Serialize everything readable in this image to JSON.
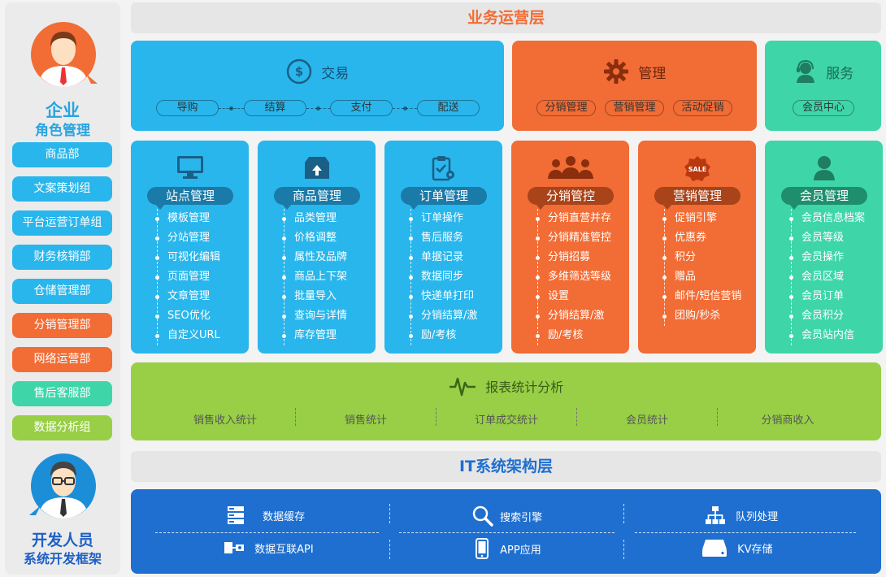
{
  "sidebar": {
    "enterprise_title": "企业",
    "enterprise_subtitle": "角色管理",
    "departments": [
      {
        "label": "商品部",
        "color": "#29b6ec"
      },
      {
        "label": "文案策划组",
        "color": "#29b6ec"
      },
      {
        "label": "平台运营订单组",
        "color": "#29b6ec"
      },
      {
        "label": "财务核销部",
        "color": "#29b6ec"
      },
      {
        "label": "仓储管理部",
        "color": "#29b6ec"
      },
      {
        "label": "分销管理部",
        "color": "#f26c35"
      },
      {
        "label": "网络运营部",
        "color": "#f26c35"
      },
      {
        "label": "售后客服部",
        "color": "#3ed6a9"
      },
      {
        "label": "数据分析组",
        "color": "#98cf46"
      }
    ],
    "developer_title": "开发人员",
    "developer_subtitle": "系统开发框架"
  },
  "business_layer": {
    "title": "业务运营层",
    "title_color": "#f26c35",
    "trade": {
      "title": "交易",
      "steps": [
        "导购",
        "结算",
        "支付",
        "配送"
      ]
    },
    "manage": {
      "title": "管理",
      "items": [
        "分销管理",
        "营销管理",
        "活动促销"
      ]
    },
    "service": {
      "title": "服务",
      "items": [
        "会员中心"
      ]
    },
    "modules": [
      {
        "title": "站点管理",
        "icon": "monitor-icon",
        "bg": "#29b6ec",
        "tag": "#1a7aa8",
        "items": [
          "模板管理",
          "分站管理",
          "可视化编辑",
          "页面管理",
          "文章管理",
          "SEO优化",
          "自定义URL"
        ]
      },
      {
        "title": "商品管理",
        "icon": "box-icon",
        "bg": "#29b6ec",
        "tag": "#1a7aa8",
        "items": [
          "品类管理",
          "价格调整",
          "属性及品牌",
          "商品上下架",
          "批量导入",
          "查询与详情",
          "库存管理"
        ]
      },
      {
        "title": "订单管理",
        "icon": "clipboard-gear-icon",
        "bg": "#29b6ec",
        "tag": "#1a7aa8",
        "items": [
          "订单操作",
          "售后服务",
          "单据记录",
          "数据同步",
          "快递单打印",
          "分销结算/激",
          "励/考核"
        ]
      },
      {
        "title": "分销管控",
        "icon": "people-group-icon",
        "bg": "#f26c35",
        "tag": "#a8431a",
        "items": [
          "分销直营并存",
          "分销精准管控",
          "分销招募",
          "多维筛选等级",
          "设置",
          "分销结算/激",
          "励/考核"
        ]
      },
      {
        "title": "营销管理",
        "icon": "sale-badge-icon",
        "bg": "#f26c35",
        "tag": "#a8431a",
        "items": [
          "促销引擎",
          "优惠券",
          "积分",
          "赠品",
          "邮件/短信营销",
          "团购/秒杀"
        ]
      },
      {
        "title": "会员管理",
        "icon": "user-icon",
        "bg": "#3ed6a9",
        "tag": "#1f8e6c",
        "items": [
          "会员信息档案",
          "会员等级",
          "会员操作",
          "会员区域",
          "会员订单",
          "会员积分",
          "会员站内信"
        ]
      }
    ],
    "sale_badge_text": "SALE",
    "report": {
      "title": "报表统计分析",
      "items": [
        "销售收入统计",
        "销售统计",
        "订单成交统计",
        "会员统计",
        "分销商收入"
      ]
    }
  },
  "it_layer": {
    "title": "IT系统架构层",
    "title_color": "#1e6fd0",
    "row1": [
      {
        "label": "数据缓存",
        "icon": "server-stack-icon"
      },
      {
        "label": "搜索引擎",
        "icon": "search-icon"
      },
      {
        "label": "队列处理",
        "icon": "hierarchy-icon"
      }
    ],
    "row2": [
      {
        "label": "数据互联API",
        "icon": "api-connector-icon"
      },
      {
        "label": "APP应用",
        "icon": "phone-icon"
      },
      {
        "label": "KV存储",
        "icon": "storage-drive-icon"
      }
    ]
  }
}
